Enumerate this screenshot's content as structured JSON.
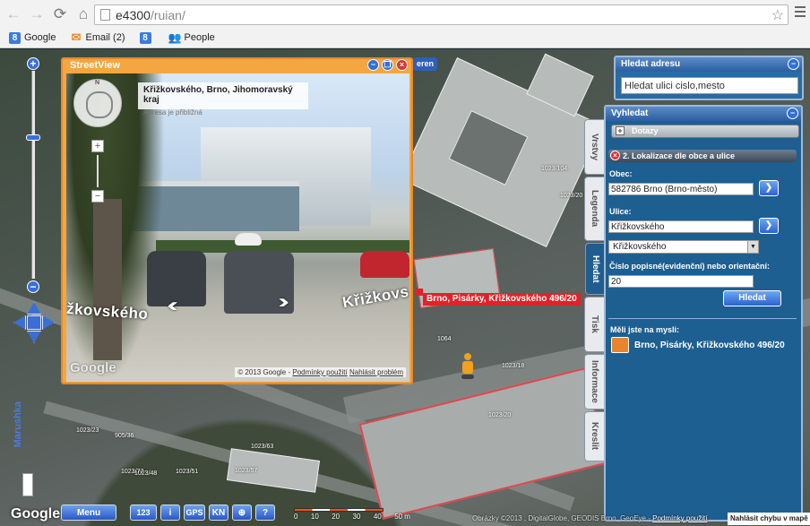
{
  "browser": {
    "url_host": "e4300",
    "url_path": "/ruian/",
    "bookmarks": [
      {
        "label": "Google",
        "icon": "google-icon",
        "color": "#3b7be0"
      },
      {
        "label": "Email (2)",
        "icon": "email-icon",
        "color": "#f28c1b"
      },
      {
        "label": "",
        "icon": "google-icon",
        "color": "#3b7be0"
      },
      {
        "label": "People",
        "icon": "people-icon",
        "color": "#e0442b"
      }
    ]
  },
  "streetview": {
    "title": "StreetView",
    "address": "Křižkovského, Brno, Jihomoravský kraj",
    "address_note": "Adresa je přibližná",
    "street_label_left": "žkovského",
    "street_label_right": "Křižkovs",
    "logo": "Google",
    "footer_copyright": "© 2013 Google",
    "footer_terms": "Podmínky použití",
    "footer_report": "Nahlásit problém",
    "compass_n": "N"
  },
  "map": {
    "tag_button": "eren",
    "address_label": "Brno, Pisárky, Křižkovského 496/20",
    "vertical_brand": "Marushka",
    "lot_numbers": [
      "1023/18",
      "1023/20",
      "1064",
      "1023/57",
      "1023/51",
      "1023/63",
      "1023/48",
      "905/36",
      "1023/77",
      "1023/104",
      "1023/20",
      "1023/23"
    ]
  },
  "side_tabs": [
    "Vrstvy",
    "Legenda",
    "Hledat",
    "Tisk",
    "Informace",
    "Kreslit"
  ],
  "active_tab": "Hledat",
  "search_address": {
    "title": "Hledat adresu",
    "input_value": "Hledat ulici cislo,mesto"
  },
  "vyhledat": {
    "title": "Vyhledat",
    "dotazy": "Dotazy",
    "section": "2. Lokalizace dle obce a ulice",
    "obec_label": "Obec:",
    "obec_value": "582786 Brno (Brno-město)",
    "ulice_label": "Ulice:",
    "ulice_value": "Křižkovského",
    "ulice_select": "Křižkovského",
    "cislo_label": "Číslo popisné(evidenční) nebo orientační:",
    "cislo_value": "20",
    "search_button": "Hledat",
    "suggest_title": "Měli jste na mysli:",
    "suggest_result": "Brno, Pisárky, Křižkovského 496/20"
  },
  "toolbar": {
    "menu": "Menu",
    "numbers": "123",
    "info": "i",
    "gps": "GPS",
    "kn": "KN",
    "help": "?",
    "google": "Google"
  },
  "scale": {
    "ticks": [
      "0",
      "10",
      "20",
      "30",
      "40",
      "50 m"
    ]
  },
  "footer": {
    "copyright": "Obrázky ©2013 , DigitalGlobe, GEODIS Brno, GeoEye -",
    "terms": "Podmínky použití",
    "report": "Nahlásit chybu v mapě"
  },
  "colors": {
    "accent": "#2b63cf",
    "panel": "#1d5f91",
    "streetview_frame": "#f4a640",
    "highlight": "#e0222a"
  }
}
